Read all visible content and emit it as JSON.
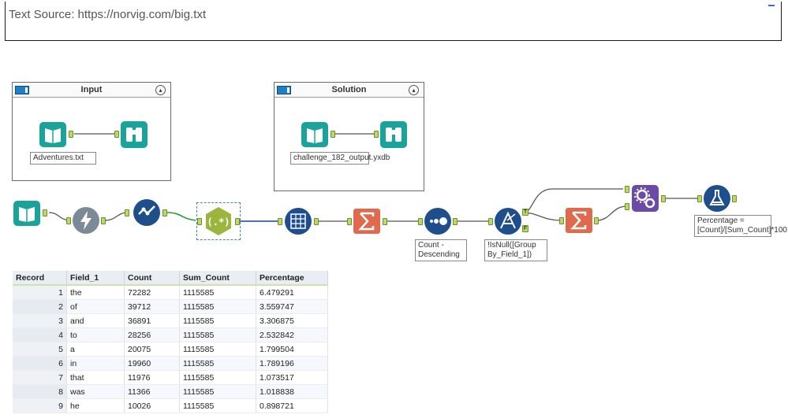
{
  "comment_box": {
    "text": "Text Source: https://norvig.com/big.txt"
  },
  "containers": {
    "input": {
      "title": "Input",
      "file_label": "Adventures.txt"
    },
    "solution": {
      "title": "Solution",
      "file_label": "challenge_182_output.yxdb"
    }
  },
  "tool_labels": {
    "sort": "Count - Descending",
    "filter": "!IsNull([Group By_Field_1])",
    "formula": "Percentage = [Count]/[Sum_Count]*100"
  },
  "filter_anchors": {
    "true": "T",
    "false": "F"
  },
  "results": {
    "columns": [
      "Record",
      "Field_1",
      "Count",
      "Sum_Count",
      "Percentage"
    ],
    "rows": [
      [
        "1",
        "the",
        "72282",
        "1115585",
        "6.479291"
      ],
      [
        "2",
        "of",
        "39712",
        "1115585",
        "3.559747"
      ],
      [
        "3",
        "and",
        "36891",
        "1115585",
        "3.306875"
      ],
      [
        "4",
        "to",
        "28256",
        "1115585",
        "2.532842"
      ],
      [
        "5",
        "a",
        "20075",
        "1115585",
        "1.799504"
      ],
      [
        "6",
        "in",
        "19960",
        "1115585",
        "1.789196"
      ],
      [
        "7",
        "that",
        "11976",
        "1115585",
        "1.073517"
      ],
      [
        "8",
        "was",
        "11366",
        "1115585",
        "1.018838"
      ],
      [
        "9",
        "he",
        "10026",
        "1115585",
        "0.898721"
      ]
    ]
  },
  "colors": {
    "input_tool": "#1aa39a",
    "browse_tool": "#1aa39a",
    "parse_tool": "#7a8a96",
    "prep_tool": "#1f4e8c",
    "regex_tool": "#9cb53e",
    "summarize_tool": "#e06a4e",
    "join_tool": "#6b4aa8",
    "formula_tool": "#1f4e8c",
    "anchor": "#b9d96a"
  }
}
